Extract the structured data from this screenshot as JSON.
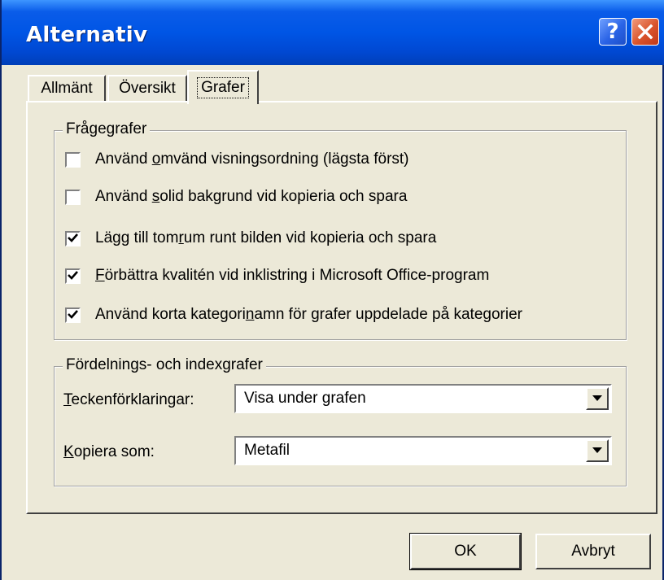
{
  "window": {
    "title": "Alternativ",
    "help_glyph": "?"
  },
  "tabs": [
    {
      "label": "Allmänt",
      "active": false
    },
    {
      "label": "Översikt",
      "active": false
    },
    {
      "label": "Grafer",
      "active": true
    }
  ],
  "question_graphs": {
    "legend": "Frågegrafer",
    "options": [
      {
        "pre": "Använd ",
        "mnemonic": "o",
        "post": "mvänd visningsordning (lägsta först)",
        "checked": false
      },
      {
        "pre": "Använd ",
        "mnemonic": "s",
        "post": "olid bakgrund vid kopieria och spara",
        "checked": false
      },
      {
        "pre": "Lägg till tom",
        "mnemonic": "r",
        "post": "um runt bilden vid kopieria och spara",
        "checked": true
      },
      {
        "pre": "",
        "mnemonic": "F",
        "post": "örbättra kvalitén vid inklistring i Microsoft Office-program",
        "checked": true
      },
      {
        "pre": "Använd korta kategori",
        "mnemonic": "n",
        "post": "amn för grafer uppdelade på kategorier",
        "checked": true
      }
    ]
  },
  "distribution_graphs": {
    "legend": "Fördelnings- och indexgrafer",
    "legend_field": {
      "mnemonic": "T",
      "label_rest": "eckenförklaringar:",
      "value": "Visa under grafen"
    },
    "copy_as_field": {
      "mnemonic": "K",
      "label_rest": "opiera som:",
      "value": "Metafil"
    }
  },
  "buttons": {
    "ok": "OK",
    "cancel": "Avbryt"
  },
  "icons": {
    "help": "help-icon",
    "close": "close-icon",
    "checkmark": "checkmark-icon",
    "dropdown": "chevron-down-icon"
  }
}
